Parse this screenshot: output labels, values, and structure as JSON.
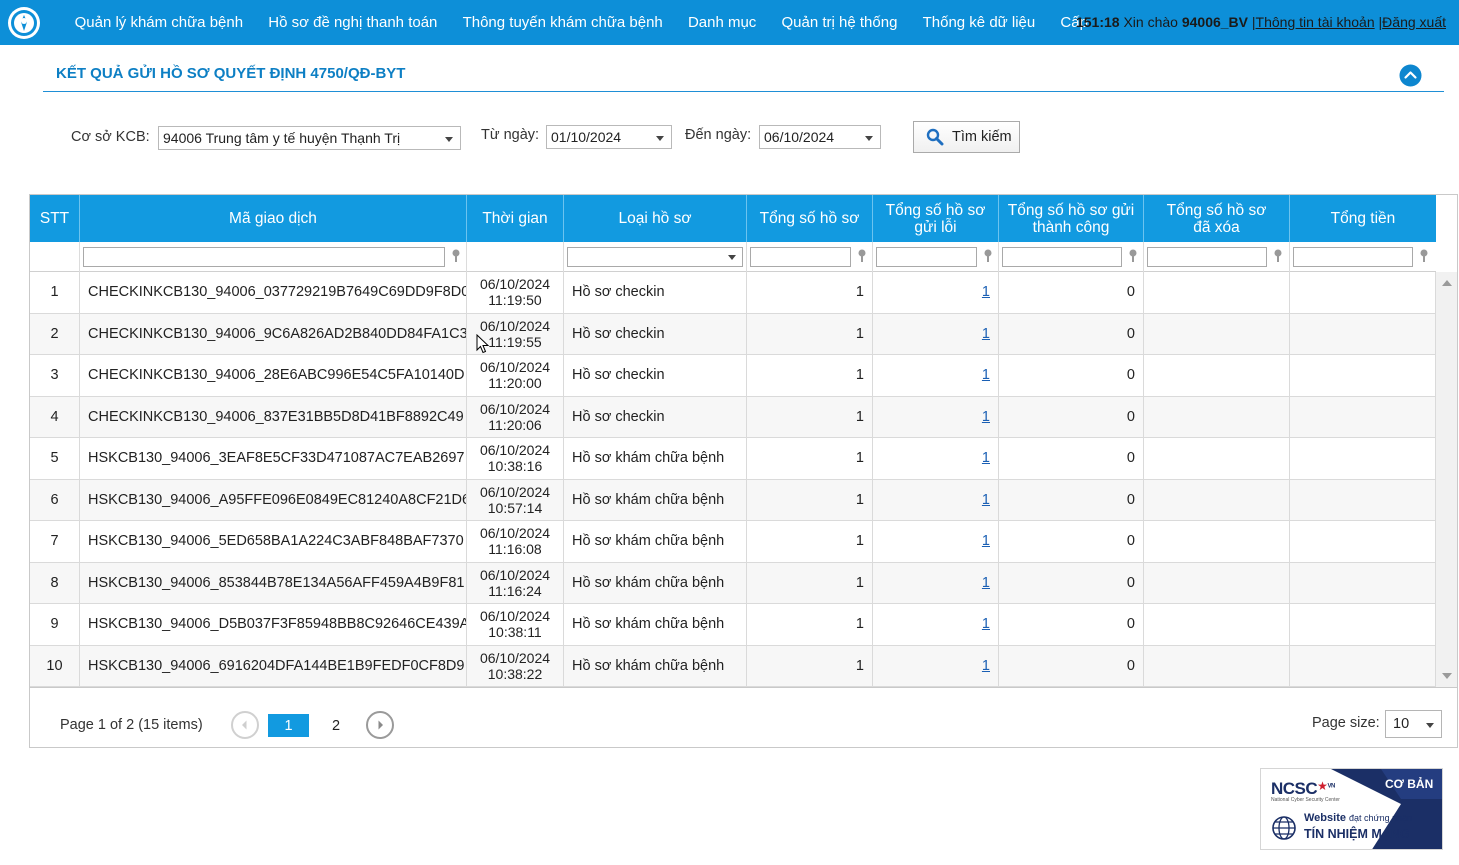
{
  "nav": {
    "items": [
      "Quản lý khám chữa bệnh",
      "Hồ sơ đề nghị thanh toán",
      "Thông tuyến khám chữa bệnh",
      "Danh mục",
      "Quản trị hệ thống",
      "Thống kê dữ liệu",
      "Cấp"
    ],
    "user": {
      "time": "151:18",
      "greeting": "Xin chào",
      "username": "94006_BV",
      "account_link": "Thông tin tài khoản",
      "logout_link": "Đăng xuất"
    }
  },
  "section": {
    "title": "KẾT QUẢ GỬI HỒ SƠ QUYẾT ĐỊNH 4750/QĐ-BYT"
  },
  "filters": {
    "facility_label": "Cơ sở KCB:",
    "facility_value": "94006 Trung tâm y tế huyện Thạnh Trị",
    "from_label": "Từ ngày:",
    "from_value": "01/10/2024",
    "to_label": "Đến ngày:",
    "to_value": "06/10/2024",
    "search_label": "Tìm kiếm"
  },
  "table": {
    "columns": [
      "STT",
      "Mã giao dịch",
      "Thời gian",
      "Loại hồ sơ",
      "Tổng số hồ sơ",
      "Tổng số hồ sơ gửi lỗi",
      "Tổng số hồ sơ gửi thành công",
      "Tổng số hồ sơ đã xóa",
      "Tổng tiền"
    ],
    "rows": [
      {
        "stt": "1",
        "code": "CHECKINKCB130_94006_037729219B7649C69DD9F8D0",
        "date": "06/10/2024",
        "time": "11:19:50",
        "type": "Hồ sơ checkin",
        "total": "1",
        "error": "1",
        "success": "0",
        "deleted": "",
        "amount": ""
      },
      {
        "stt": "2",
        "code": "CHECKINKCB130_94006_9C6A826AD2B840DD84FA1C3",
        "date": "06/10/2024",
        "time": "11:19:55",
        "type": "Hồ sơ checkin",
        "total": "1",
        "error": "1",
        "success": "0",
        "deleted": "",
        "amount": ""
      },
      {
        "stt": "3",
        "code": "CHECKINKCB130_94006_28E6ABC996E54C5FA10140D",
        "date": "06/10/2024",
        "time": "11:20:00",
        "type": "Hồ sơ checkin",
        "total": "1",
        "error": "1",
        "success": "0",
        "deleted": "",
        "amount": ""
      },
      {
        "stt": "4",
        "code": "CHECKINKCB130_94006_837E31BB5D8D41BF8892C49",
        "date": "06/10/2024",
        "time": "11:20:06",
        "type": "Hồ sơ checkin",
        "total": "1",
        "error": "1",
        "success": "0",
        "deleted": "",
        "amount": ""
      },
      {
        "stt": "5",
        "code": "HSKCB130_94006_3EAF8E5CF33D471087AC7EAB2697",
        "date": "06/10/2024",
        "time": "10:38:16",
        "type": "Hồ sơ khám chữa bệnh",
        "total": "1",
        "error": "1",
        "success": "0",
        "deleted": "",
        "amount": ""
      },
      {
        "stt": "6",
        "code": "HSKCB130_94006_A95FFE096E0849EC81240A8CF21D6",
        "date": "06/10/2024",
        "time": "10:57:14",
        "type": "Hồ sơ khám chữa bệnh",
        "total": "1",
        "error": "1",
        "success": "0",
        "deleted": "",
        "amount": ""
      },
      {
        "stt": "7",
        "code": "HSKCB130_94006_5ED658BA1A224C3ABF848BAF7370",
        "date": "06/10/2024",
        "time": "11:16:08",
        "type": "Hồ sơ khám chữa bệnh",
        "total": "1",
        "error": "1",
        "success": "0",
        "deleted": "",
        "amount": ""
      },
      {
        "stt": "8",
        "code": "HSKCB130_94006_853844B78E134A56AFF459A4B9F81",
        "date": "06/10/2024",
        "time": "11:16:24",
        "type": "Hồ sơ khám chữa bệnh",
        "total": "1",
        "error": "1",
        "success": "0",
        "deleted": "",
        "amount": ""
      },
      {
        "stt": "9",
        "code": "HSKCB130_94006_D5B037F3F85948BB8C92646CE439A",
        "date": "06/10/2024",
        "time": "10:38:11",
        "type": "Hồ sơ khám chữa bệnh",
        "total": "1",
        "error": "1",
        "success": "0",
        "deleted": "",
        "amount": ""
      },
      {
        "stt": "10",
        "code": "HSKCB130_94006_6916204DFA144BE1B9FEDF0CF8D9",
        "date": "06/10/2024",
        "time": "10:38:22",
        "type": "Hồ sơ khám chữa bệnh",
        "total": "1",
        "error": "1",
        "success": "0",
        "deleted": "",
        "amount": ""
      }
    ]
  },
  "pager": {
    "info": "Page 1 of 2 (15 items)",
    "pages": [
      "1",
      "2"
    ],
    "current": "1",
    "size_label": "Page size:",
    "size_value": "10"
  },
  "badge": {
    "brand": "NCSC",
    "brand_sup": "VN",
    "org": "National Cyber Security Center",
    "level": "CƠ BẢN",
    "line1": "Website",
    "line1b": "đạt chứng nhận",
    "line2": "TÍN NHIỆM MẠNG"
  },
  "colors": {
    "nav_bg": "#0d8fd8",
    "header_bg": "#129ae0",
    "title": "#0d7fc4",
    "link": "#1a5fb4"
  }
}
